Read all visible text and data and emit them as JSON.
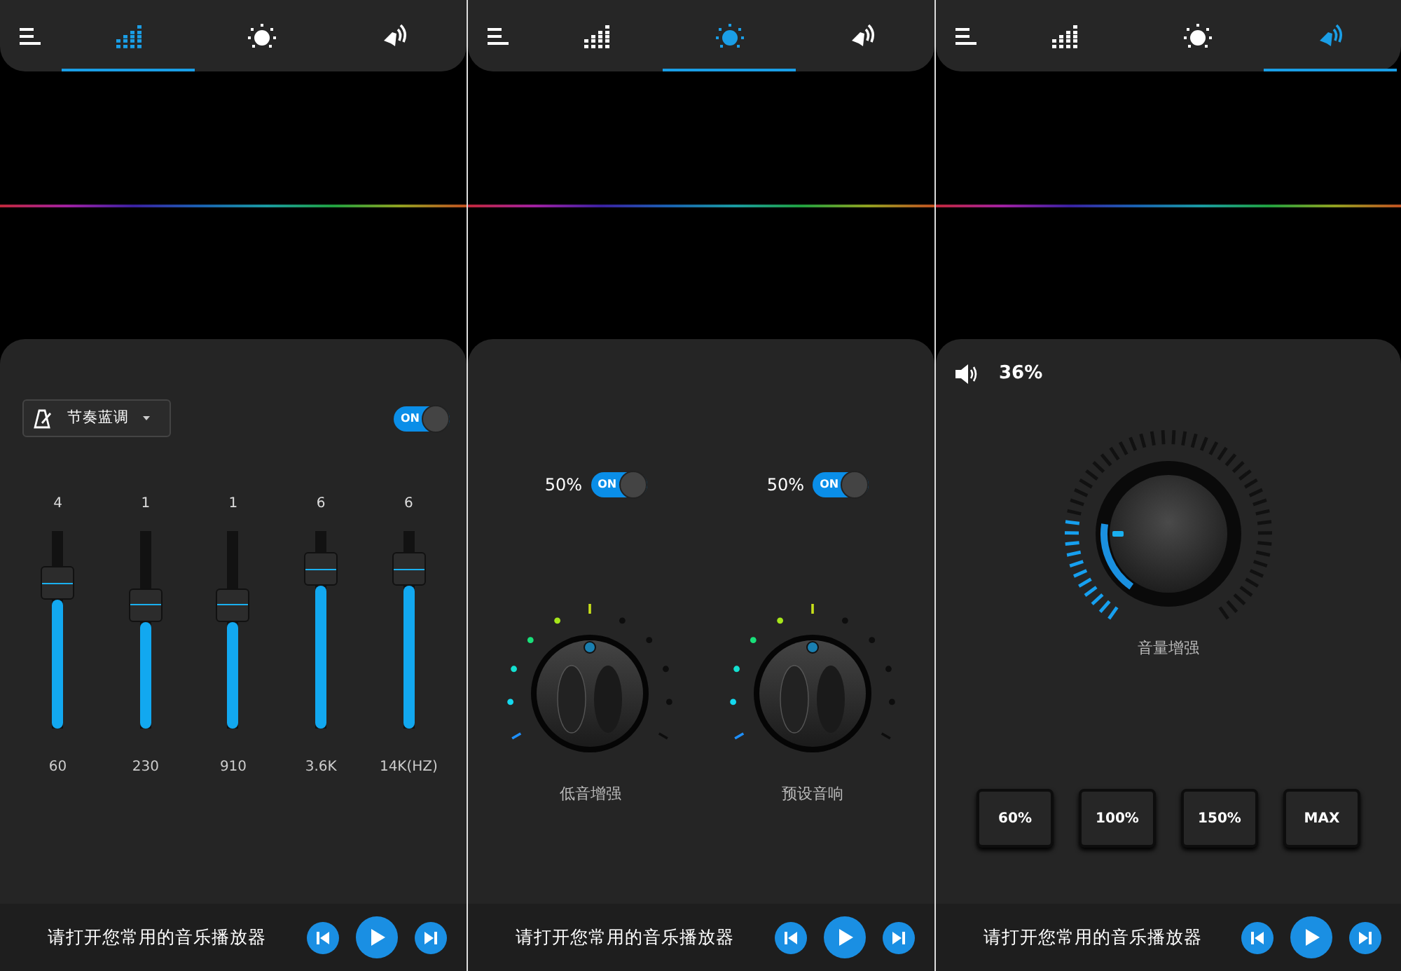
{
  "screens": [
    {
      "kind": "equalizer",
      "tabs": [
        {
          "kind": "equalizer",
          "selected": true
        },
        {
          "kind": "effects",
          "selected": false
        },
        {
          "kind": "volume",
          "selected": false
        }
      ],
      "preset": {
        "label": "节奏蓝调"
      },
      "toggle": {
        "on": true,
        "label": "ON"
      },
      "bands": [
        {
          "value": "4",
          "freq": "60",
          "level": 0.65
        },
        {
          "value": "1",
          "freq": "230",
          "level": 0.54
        },
        {
          "value": "1",
          "freq": "910",
          "level": 0.54
        },
        {
          "value": "6",
          "freq": "3.6K",
          "level": 0.72
        },
        {
          "value": "6",
          "freq": "14K(HZ)",
          "level": 0.72
        }
      ],
      "player": {
        "message": "请打开您常用的音乐播放器"
      }
    },
    {
      "kind": "effects",
      "tabs": [
        {
          "kind": "equalizer",
          "selected": false
        },
        {
          "kind": "effects",
          "selected": true
        },
        {
          "kind": "volume",
          "selected": false
        }
      ],
      "knobs": [
        {
          "reading": "50%",
          "toggle": {
            "on": true,
            "label": "ON"
          },
          "label": "低音增强",
          "level": 0.5
        },
        {
          "reading": "50%",
          "toggle": {
            "on": true,
            "label": "ON"
          },
          "label": "预设音响",
          "level": 0.5
        }
      ],
      "player": {
        "message": "请打开您常用的音乐播放器"
      }
    },
    {
      "kind": "volume",
      "tabs": [
        {
          "kind": "equalizer",
          "selected": false
        },
        {
          "kind": "effects",
          "selected": false
        },
        {
          "kind": "volume",
          "selected": true
        }
      ],
      "reading": "36%",
      "level": 0.22,
      "label": "音量增强",
      "presets": [
        "60%",
        "100%",
        "150%",
        "MAX"
      ],
      "player": {
        "message": "请打开您常用的音乐播放器"
      }
    }
  ]
}
